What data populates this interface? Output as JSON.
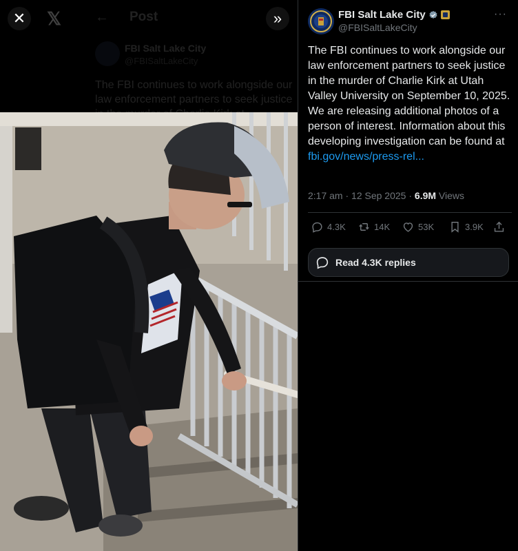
{
  "viewer": {
    "close_icon": "close-icon",
    "logo_icon": "x-logo-icon",
    "expand_icon": "chevrons-right-icon",
    "underlay": {
      "back_icon": "arrow-left-icon",
      "title": "Post",
      "name": "FBI Salt Lake City",
      "handle": "@FBISaltLakeCity",
      "text": "The FBI continues to work alongside our law enforcement partners to seek justice in the murder of Charlie Kirk at"
    },
    "photo_description": "surveillance-photo-person-of-interest"
  },
  "tweet": {
    "author": {
      "name": "FBI Salt Lake City",
      "handle": "@FBISaltLakeCity",
      "verified": true,
      "verified_color": "#829aab",
      "affiliate_badge": "fbi-seal-badge"
    },
    "more_label": "···",
    "text": "The FBI continues to work alongside our law enforcement partners to seek justice in the murder of Charlie Kirk at Utah Valley University on September 10, 2025. We are releasing additional photos of a person of interest. Information about this developing investigation can be found at ",
    "link": "fbi.gov/news/press-rel...",
    "link_color": "#1d9bf0",
    "meta": {
      "time": "2:17 am",
      "separator": " · ",
      "date": "12 Sep 2025",
      "views_count": "6.9M",
      "views_label": "Views"
    },
    "actions": {
      "replies": "4.3K",
      "reposts": "14K",
      "likes": "53K",
      "bookmarks": "3.9K"
    },
    "read_replies": "Read 4.3K replies"
  },
  "colors": {
    "background": "#000000",
    "text": "#e7e9ea",
    "muted": "#71767b",
    "border": "#2f3336",
    "accent": "#1d9bf0"
  }
}
